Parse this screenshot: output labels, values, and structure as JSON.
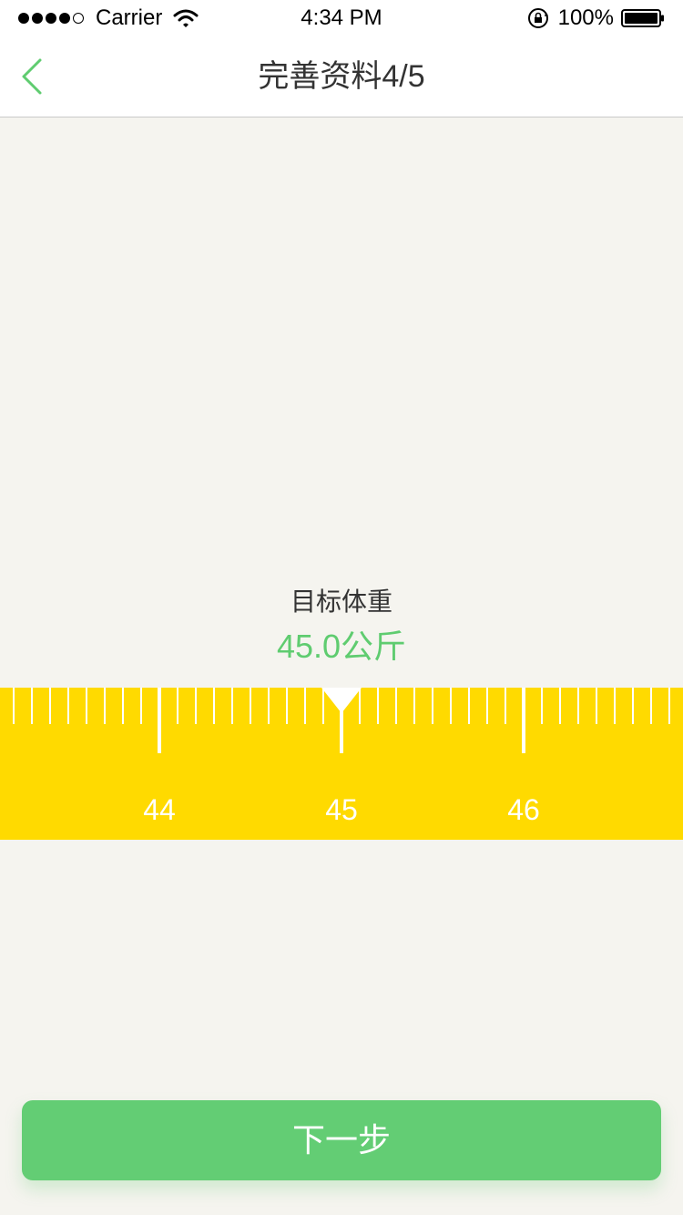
{
  "status_bar": {
    "carrier": "Carrier",
    "time": "4:34 PM",
    "battery_percent": "100%",
    "signal_bars_filled": 4,
    "signal_bars_total": 5
  },
  "nav": {
    "title": "完善资料4/5",
    "back_icon": "chevron-left-icon"
  },
  "target": {
    "label": "目标体重",
    "value": "45.0",
    "unit": "公斤"
  },
  "ruler": {
    "labels": [
      "44",
      "45",
      "46"
    ],
    "selected": 45.0
  },
  "next_button": {
    "label": "下一步"
  },
  "colors": {
    "accent_green": "#63cd74",
    "ruler_yellow": "#ffda00",
    "background": "#f5f4ef"
  }
}
